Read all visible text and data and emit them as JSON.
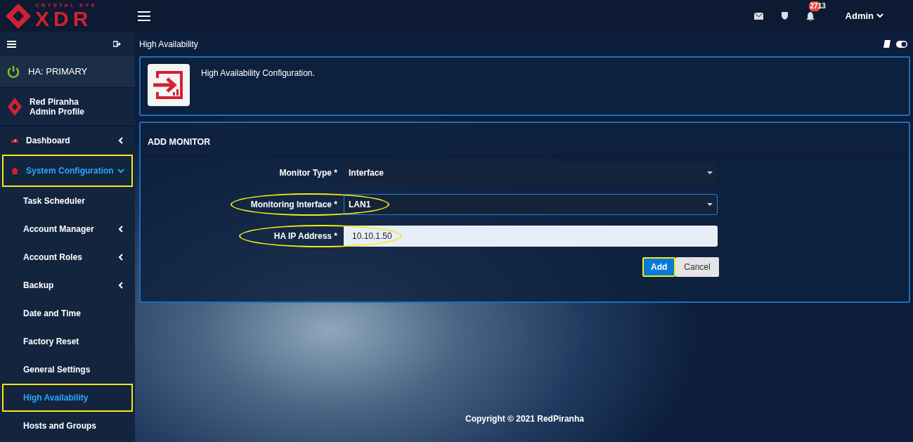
{
  "brand": {
    "tagline": "CRYSTAL EYE",
    "name": "XDR"
  },
  "topbar": {
    "notification_count": "2713",
    "user": "Admin"
  },
  "sidebar": {
    "status": "HA: PRIMARY",
    "profile": {
      "name": "Red Piranha",
      "role": "Admin Profile"
    },
    "items": [
      {
        "label": "Dashboard",
        "kind": "collapsible",
        "expanded": false,
        "selected": false,
        "highlighted": false
      },
      {
        "label": "System Configuration",
        "kind": "collapsible",
        "expanded": true,
        "selected": true,
        "highlighted": true,
        "children": [
          {
            "label": "Task Scheduler",
            "kind": "leaf",
            "selected": false,
            "highlighted": false
          },
          {
            "label": "Account Manager",
            "kind": "collapsible",
            "expanded": false,
            "selected": false,
            "highlighted": false
          },
          {
            "label": "Account Roles",
            "kind": "collapsible",
            "expanded": false,
            "selected": false,
            "highlighted": false
          },
          {
            "label": "Backup",
            "kind": "collapsible",
            "expanded": false,
            "selected": false,
            "highlighted": false
          },
          {
            "label": "Date and Time",
            "kind": "leaf",
            "selected": false,
            "highlighted": false
          },
          {
            "label": "Factory Reset",
            "kind": "leaf",
            "selected": false,
            "highlighted": false
          },
          {
            "label": "General Settings",
            "kind": "leaf",
            "selected": false,
            "highlighted": false
          },
          {
            "label": "High Availability",
            "kind": "leaf",
            "selected": true,
            "highlighted": true
          },
          {
            "label": "Hosts and Groups",
            "kind": "leaf",
            "selected": false,
            "highlighted": false
          }
        ]
      }
    ]
  },
  "page": {
    "title": "High Availability",
    "info": "High Availability Configuration.",
    "form": {
      "title": "ADD MONITOR",
      "fields": [
        {
          "label": "Monitor Type *",
          "kind": "select",
          "value": "Interface",
          "focused": false,
          "highlighted": false
        },
        {
          "label": "Monitoring Interface *",
          "kind": "select",
          "value": "LAN1",
          "focused": true,
          "highlighted": true
        },
        {
          "label": "HA IP Address *",
          "kind": "text",
          "value": "10.10.1.50",
          "focused": false,
          "highlighted": true
        }
      ],
      "buttons": [
        {
          "label": "Add",
          "kind": "primary",
          "highlighted": true
        },
        {
          "label": "Cancel",
          "kind": "secondary",
          "highlighted": false
        }
      ]
    }
  },
  "footer": "Copyright © 2021 RedPiranha"
}
